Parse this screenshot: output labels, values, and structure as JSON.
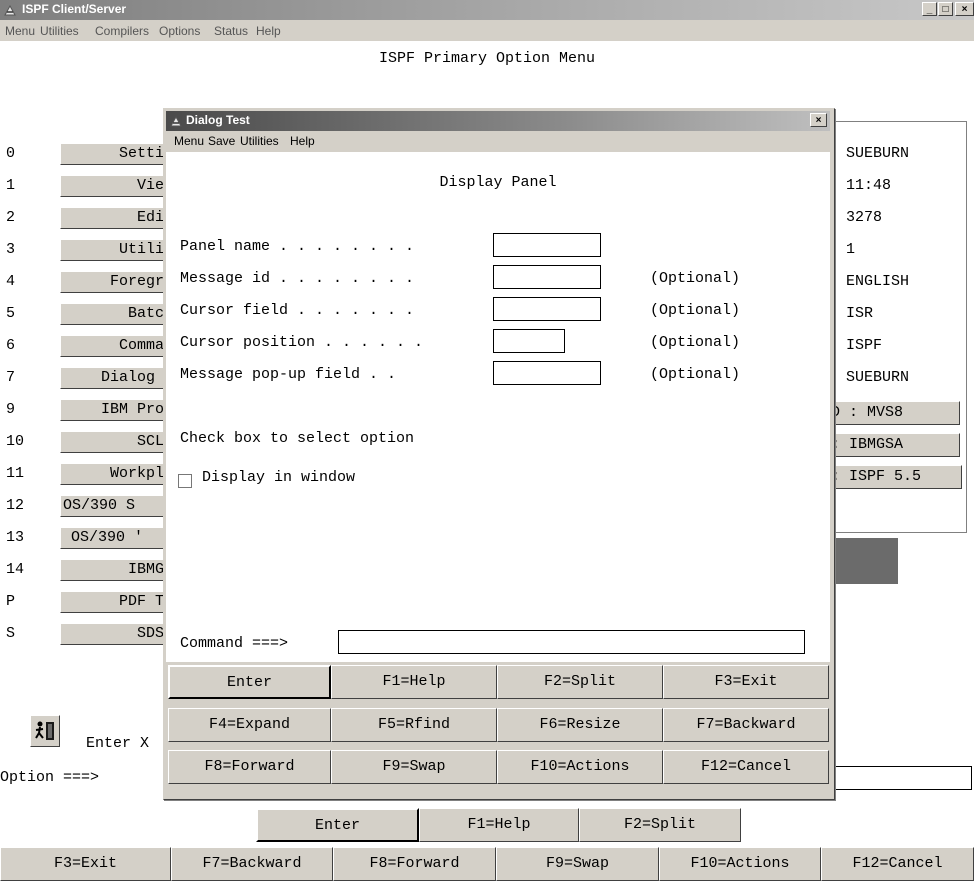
{
  "window": {
    "title": "ISPF Client/Server",
    "controls": [
      "_",
      "□",
      "×"
    ]
  },
  "menubar": [
    "Menu",
    "Utilities",
    "Compilers",
    "Options",
    "Status",
    "Help"
  ],
  "panel": {
    "title": "ISPF Primary Option Menu",
    "options": [
      {
        "num": "0",
        "label": "Settir"
      },
      {
        "num": "1",
        "label": "View"
      },
      {
        "num": "2",
        "label": "Edit"
      },
      {
        "num": "3",
        "label": "Utilit"
      },
      {
        "num": "4",
        "label": "Foregrc"
      },
      {
        "num": "5",
        "label": "Batcl"
      },
      {
        "num": "6",
        "label": "Comma:"
      },
      {
        "num": "7",
        "label": "Dialog '"
      },
      {
        "num": "9",
        "label": "IBM Prod"
      },
      {
        "num": "10",
        "label": "SCLI"
      },
      {
        "num": "11",
        "label": "Workpl."
      },
      {
        "num": "12",
        "label": "OS/390 S"
      },
      {
        "num": "13",
        "label": "OS/390 '"
      },
      {
        "num": "14",
        "label": "IBMGS"
      },
      {
        "num": "P",
        "label": "PDF To"
      },
      {
        "num": "S",
        "label": "SDSF"
      }
    ],
    "info_text": [
      ": SUEBURN",
      ": 11:48",
      ": 3278",
      ": 1",
      ": ENGLISH",
      ": ISR",
      ": ISPF",
      ": SUEBURN"
    ],
    "info_buttons": [
      "D : MVS8",
      ": IBMGSA",
      ": ISPF 5.5"
    ],
    "enter_text": "Enter X",
    "option_prompt": "Option ===>",
    "option_value": "",
    "fkeys_row1": [
      "Enter",
      "F1=Help",
      "F2=Split"
    ],
    "fkeys_row2": [
      "F3=Exit",
      "F7=Backward",
      "F8=Forward",
      "F9=Swap",
      "F10=Actions",
      "F12=Cancel"
    ]
  },
  "dialog": {
    "title": "Dialog Test",
    "close": "×",
    "menubar": [
      "Menu",
      "Save",
      "Utilities",
      "Help"
    ],
    "heading": "Display Panel",
    "fields": [
      {
        "label": "Panel name . . . . . . . .",
        "value": "",
        "note": ""
      },
      {
        "label": "Message id . . . . . . . .",
        "value": "",
        "note": "(Optional)"
      },
      {
        "label": "Cursor field . . . . . . .",
        "value": "",
        "note": "(Optional)"
      },
      {
        "label": "Cursor position . . . . . .",
        "value": "",
        "note": "(Optional)"
      },
      {
        "label": "Message pop-up field . .",
        "value": "",
        "note": "(Optional)"
      }
    ],
    "checkbox_heading": "Check box to select option",
    "checkbox_label": "Display in window",
    "checkbox_checked": false,
    "command_prompt": "Command ===>",
    "command_value": "",
    "fkeys": [
      [
        "Enter",
        "F1=Help",
        "F2=Split",
        "F3=Exit"
      ],
      [
        "F4=Expand",
        "F5=Rfind",
        "F6=Resize",
        "F7=Backward"
      ],
      [
        "F8=Forward",
        "F9=Swap",
        "F10=Actions",
        "F12=Cancel"
      ]
    ]
  }
}
